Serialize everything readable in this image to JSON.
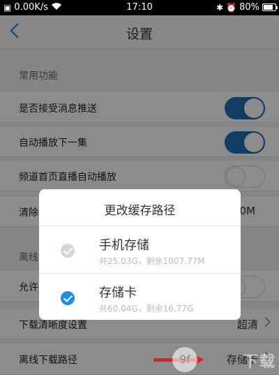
{
  "status_bar": {
    "network_speed": "0.00K/s",
    "time": "17:10",
    "battery_percent": "80%",
    "battery_level": 0.8,
    "icons": [
      "image-icon",
      "wifi-icon",
      "bluetooth-icon",
      "alarm-icon",
      "battery-icon"
    ]
  },
  "header": {
    "title": "设置",
    "back_icon": "chevron-left-icon"
  },
  "sections": {
    "common_label": "常用功能",
    "offline_label": "离线"
  },
  "rows": {
    "push": {
      "label": "是否接受消息推送",
      "toggle": true
    },
    "autoplay_next": {
      "label": "自动播放下一集",
      "toggle": true
    },
    "channel_autoplay": {
      "label": "频道首页直播自动播放",
      "toggle": false
    },
    "clear": {
      "label": "清除",
      "value": "0M"
    },
    "allow": {
      "label": "允许",
      "toggle": false
    },
    "download_quality": {
      "label": "下载清晰度设置",
      "value": "超清"
    },
    "offline_path": {
      "label": "离线下载路径",
      "value": "存储卡"
    }
  },
  "dialog": {
    "title": "更改缓存路径",
    "options": [
      {
        "name": "手机存储",
        "detail": "共25.03G，剩余1007.77M",
        "selected": false
      },
      {
        "name": "存储卡",
        "detail": "共60.04G，剩余16.77G",
        "selected": true
      }
    ]
  },
  "watermark": {
    "logo": "9f",
    "text": "下载"
  },
  "colors": {
    "accent": "#1f6fb5",
    "check_selected": "#1f8ee0",
    "annotation_arrow": "#e02020"
  }
}
